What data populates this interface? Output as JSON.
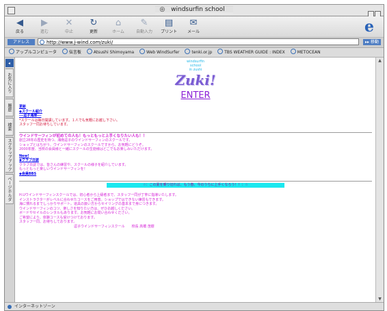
{
  "window": {
    "title": "windsurfin school"
  },
  "toolbar": {
    "buttons": [
      {
        "label": "戻る",
        "icon": "back-arrow-icon"
      },
      {
        "label": "進む",
        "icon": "forward-arrow-icon"
      },
      {
        "label": "中止",
        "icon": "stop-icon"
      },
      {
        "label": "更新",
        "icon": "refresh-icon"
      },
      {
        "label": "ホーム",
        "icon": "home-icon"
      },
      {
        "label": "自動入力",
        "icon": "autofill-icon"
      },
      {
        "label": "プリント",
        "icon": "print-icon"
      },
      {
        "label": "メール",
        "icon": "mail-icon"
      }
    ]
  },
  "address": {
    "label": "アドレス",
    "url": "http://www.j-wind.com/zuki/",
    "go": "移動"
  },
  "favorites": [
    "アップルコンピュータ",
    "伝言板",
    "Atsushi Shimoyama",
    "Web WindSurfer",
    "tenki.or.jp",
    "TBS WEATHER GUIDE : INDEX",
    "METOCEAN"
  ],
  "sidebar": {
    "tabs": [
      "お気に入り",
      "履歴",
      "検索",
      "スクラップブック",
      "ページホルダ"
    ]
  },
  "page": {
    "logo_lines": [
      "windsurfin",
      "school",
      "in zushi"
    ],
    "logo_text": "Zuki!",
    "enter": "ENTER",
    "sec1_links": [
      "更新",
      "◆スクール紹介",
      "---逗子海岸---"
    ],
    "sec1_notes": [
      "*スクールは毎日開講しています。１人でも気軽にお越し下さい。",
      "スタッフ一同お待ちしています。"
    ],
    "sec2_title": "ウインドサーフィンが初めての人も！もっともっと上手くなりたい人も！！",
    "sec2_lines": [
      "創立28年の歴史を持つ、湘南逗子のウインドサーフィンのスクールです。",
      "ショップとはちがう、ウインドサーフィンのスクールですから、お気軽にどうぞ。",
      "2000年度、当校の会員様と一緒にスクールの生徒様はどこでもお楽しみいただけます。"
    ],
    "sec2_links": [
      "New!",
      "◆クラブ日誌"
    ],
    "sec2_club_lines": [
      "クラブ日誌では、皆さんの練習や、スクールの様子を紹介しています。",
      "もっともっと楽しいウインドサーフィンを！"
    ],
    "sec2_member": "◆会員BBS",
    "banner": "☆：この夏を乗り切れば、もう春。今のうちに上手くなろう！！：☆",
    "footer_lines": [
      "H.Uウインドサーフィンスクールでは、初心者から上級者まで、スタッフ一同が丁寧に指導いたします。",
      "インストラクターがレベルに合わせたコースをご用意。ショップではできない練習もできます。",
      "海に慣れるまでしっかりサポート。道具の扱い方からセイリングの基本まで身につきます。",
      "ウインドサーフィンのコツ、楽しさを知りたい方は、ぜひお越しください。",
      "ボードやセイルのレンタルもあります。お気軽にお問い合わせください。",
      "ご希望により、体験コースも受けつけております。",
      "スタッフ一同、お待ちしております。"
    ],
    "footer_sign": "逗子ウインドサーフィンスクール　　校長 高橋 茂樹"
  },
  "status": {
    "text": "インターネットゾーン"
  }
}
